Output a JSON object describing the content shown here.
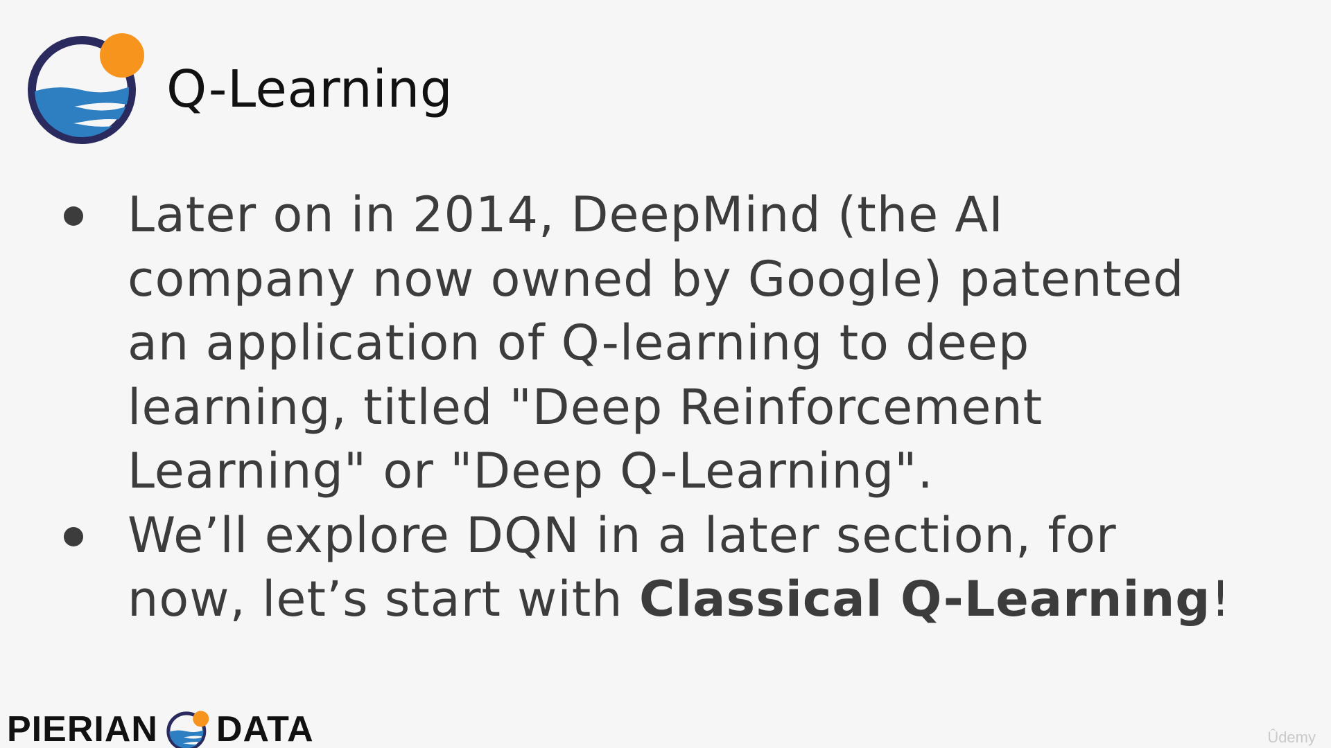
{
  "slide": {
    "title": "Q-Learning",
    "bullets": [
      {
        "lines": [
          "Later on in 2014, DeepMind (the AI",
          "company now owned by Google) patented",
          "an application of Q-learning to deep",
          "learning, titled \"Deep Reinforcement",
          "Learning\" or \"Deep Q-Learning\"."
        ]
      },
      {
        "line1": "We’ll explore DQN in a later section, for",
        "line2_prefix": "now, let’s start with ",
        "line2_bold": "Classical Q-Learning",
        "line2_suffix": "!"
      }
    ]
  },
  "footer": {
    "brand_left": "PIERIAN",
    "brand_right": "DATA",
    "logo_icon": "pierian-data-logo-icon"
  },
  "watermark": "Ûdemy",
  "colors": {
    "ring": "#2a2a5e",
    "sun": "#f7941d",
    "wave": "#2e7fc1",
    "body_text": "#3c3c3c",
    "title_text": "#111111"
  }
}
